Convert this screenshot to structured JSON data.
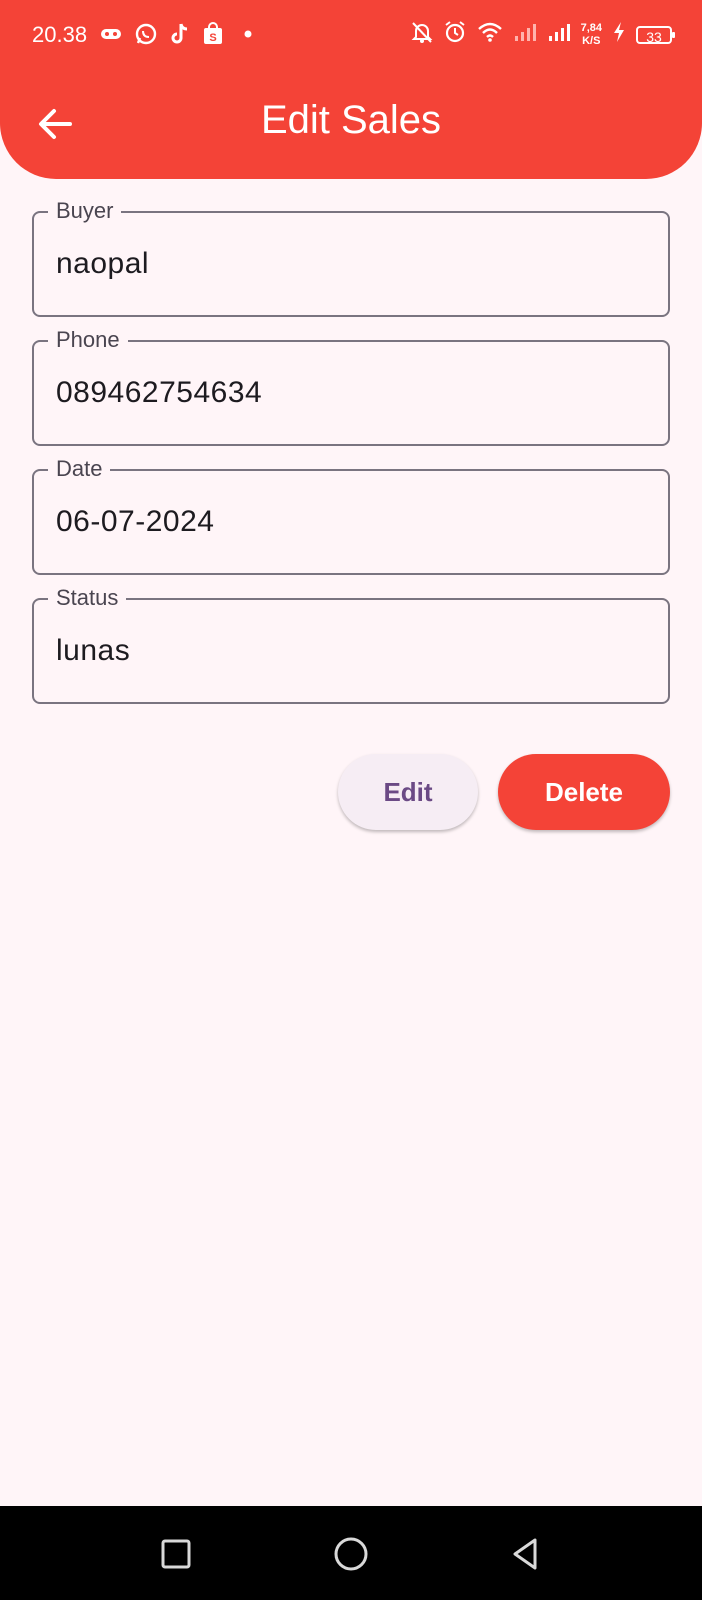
{
  "status_bar": {
    "time": "20.38",
    "net_speed_value": "7,84",
    "net_speed_unit": "K/S",
    "battery": "33"
  },
  "app_bar": {
    "title": "Edit Sales"
  },
  "form": {
    "buyer": {
      "label": "Buyer",
      "value": "naopal"
    },
    "phone": {
      "label": "Phone",
      "value": "089462754634"
    },
    "date": {
      "label": "Date",
      "value": "06-07-2024"
    },
    "status": {
      "label": "Status",
      "value": "lunas"
    }
  },
  "actions": {
    "edit_label": "Edit",
    "delete_label": "Delete"
  },
  "colors": {
    "primary": "#f44337",
    "background": "#fff5f8",
    "edit_text": "#6b4a85"
  }
}
